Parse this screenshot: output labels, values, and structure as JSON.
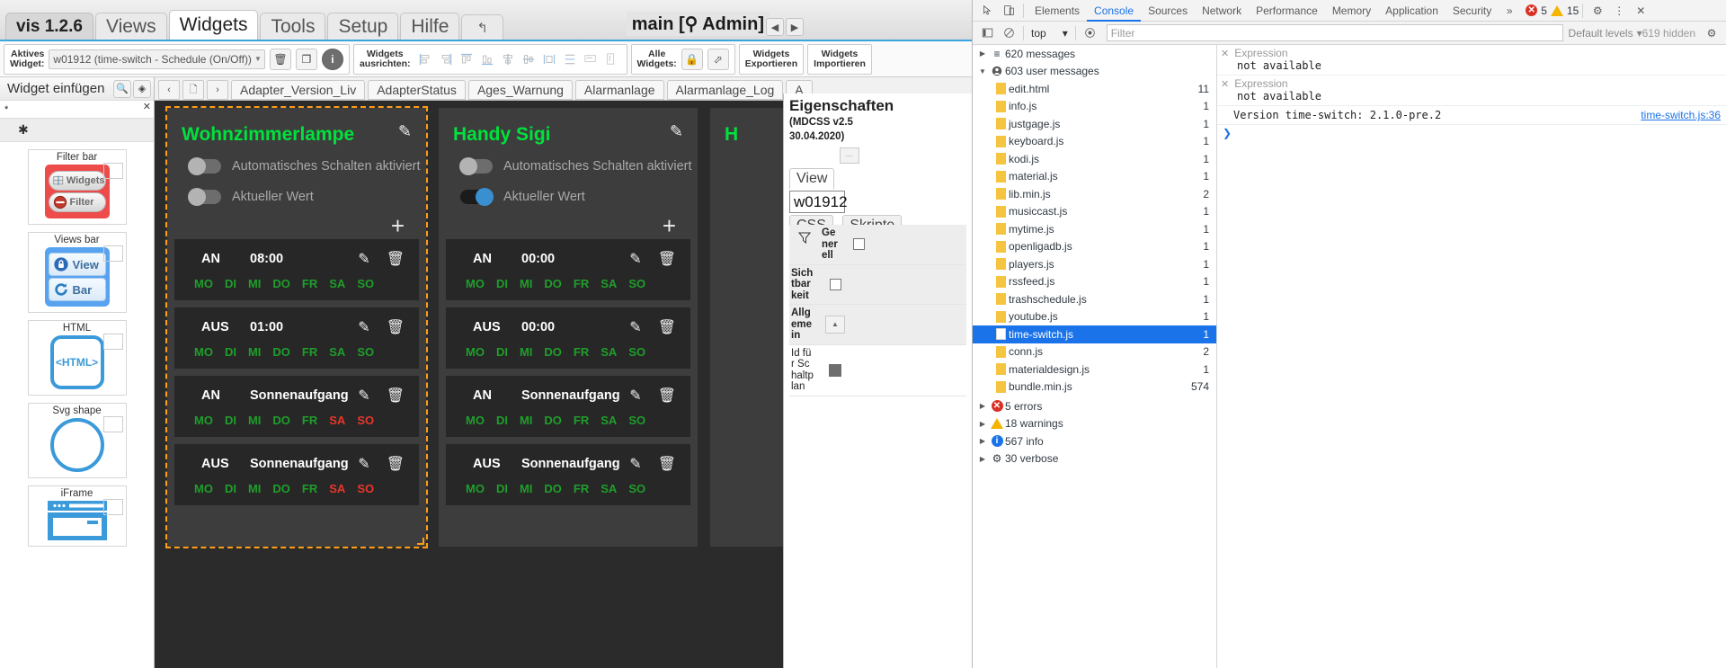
{
  "vis": {
    "menu": {
      "brand": "vis 1.2.6",
      "tabs": [
        "Views",
        "Widgets",
        "Tools",
        "Setup",
        "Hilfe"
      ],
      "active_tab": "Widgets",
      "undo_icon": "undo-arrow-icon",
      "window_title": "main [⚲ Admin]",
      "nav_prev": "◀",
      "nav_next": "▶"
    },
    "toolbar": {
      "active_widget_label": "Aktives\nWidget:",
      "active_widget_value": "w01912 (time-switch - Schedule (On/Off))",
      "delete_icon": "trash-icon",
      "copy_icon": "copy-icon",
      "info_icon": "info-icon",
      "align_label": "Widgets\nausrichten:",
      "align_icons": [
        "align-left-icon",
        "align-right-icon",
        "align-top-icon",
        "align-bottom-icon",
        "align-h-center-icon",
        "align-v-center-icon",
        "distribute-h-icon",
        "distribute-v-icon",
        "same-width-icon",
        "same-height-icon"
      ],
      "all_widgets_label": "Alle\nWidgets:",
      "lock_icon": "lock-icon",
      "expand_icon": "expand-icon",
      "export_label": "Widgets\nExportieren",
      "import_label": "Widgets\nImportieren"
    },
    "palette": {
      "title": "Widget einfügen",
      "search_icon": "search-icon",
      "pin_icon": "pin-icon",
      "close_icon": "close-icon",
      "filter_value": "*",
      "selected_group": "✱",
      "dropdown_icon": "chevron-down-icon",
      "items": [
        {
          "title": "Filter bar",
          "kind": "filter-bar",
          "buttons": [
            {
              "label": "Widgets",
              "icon": "grid-icon"
            },
            {
              "label": "Filter",
              "icon": "no-entry-icon"
            }
          ]
        },
        {
          "title": "Views bar",
          "kind": "views-bar",
          "buttons": [
            {
              "label": "View",
              "icon": "lock-circle-icon"
            },
            {
              "label": "Bar",
              "icon": "refresh-circle-icon"
            }
          ]
        },
        {
          "title": "HTML",
          "kind": "html",
          "glyph": "<HTML>"
        },
        {
          "title": "Svg shape",
          "kind": "svg"
        },
        {
          "title": "iFrame",
          "kind": "iframe"
        }
      ]
    },
    "view_tabs": {
      "prev_icon": "chevron-left-icon",
      "copy_icon": "copy-view-icon",
      "next_icon": "chevron-right-icon",
      "tabs": [
        "Adapter_Version_Liv",
        "AdapterStatus",
        "Ages_Warnung",
        "Alarmanlage",
        "Alarmanlage_Log",
        "A"
      ]
    },
    "widgets": [
      {
        "title": "Wohnzimmerlampe",
        "selected": true,
        "edit_icon": "pencil-icon",
        "add_icon": "plus-icon",
        "toggles": [
          {
            "label": "Automatisches Schalten aktiviert",
            "on": false
          },
          {
            "label": "Aktueller Wert",
            "on": false
          }
        ],
        "schedules": [
          {
            "mode": "AN",
            "time": "08:00",
            "days": [
              true,
              true,
              true,
              true,
              true,
              true,
              true
            ]
          },
          {
            "mode": "AUS",
            "time": "01:00",
            "days": [
              true,
              true,
              true,
              true,
              true,
              true,
              true
            ]
          },
          {
            "mode": "AN",
            "time": "Sonnenaufgang",
            "days": [
              true,
              true,
              true,
              true,
              true,
              false,
              false
            ]
          },
          {
            "mode": "AUS",
            "time": "Sonnenaufgang",
            "days": [
              true,
              true,
              true,
              true,
              true,
              false,
              false
            ]
          }
        ]
      },
      {
        "title": "Handy Sigi",
        "selected": false,
        "edit_icon": "pencil-icon",
        "add_icon": "plus-icon",
        "toggles": [
          {
            "label": "Automatisches Schalten aktiviert",
            "on": false
          },
          {
            "label": "Aktueller Wert",
            "on": true
          }
        ],
        "schedules": [
          {
            "mode": "AN",
            "time": "00:00",
            "days": [
              true,
              true,
              true,
              true,
              true,
              true,
              true
            ]
          },
          {
            "mode": "AUS",
            "time": "00:00",
            "days": [
              true,
              true,
              true,
              true,
              true,
              true,
              true
            ]
          },
          {
            "mode": "AN",
            "time": "Sonnenaufgang",
            "days": [
              true,
              true,
              true,
              true,
              true,
              true,
              true
            ]
          },
          {
            "mode": "AUS",
            "time": "Sonnenaufgang",
            "days": [
              true,
              true,
              true,
              true,
              true,
              true,
              true
            ]
          }
        ]
      },
      {
        "title": "H",
        "selected": false,
        "edit_icon": "pencil-icon",
        "add_icon": "plus-icon",
        "toggles": [],
        "schedules": []
      }
    ],
    "day_labels": [
      "MO",
      "DI",
      "MI",
      "DO",
      "FR",
      "SA",
      "SO"
    ],
    "day_on_color": "#1f9e2b",
    "day_off_color": "#e8372c",
    "title_color": "#00e23c",
    "selection_color": "#ff9d17",
    "properties": {
      "title": "Eigenschaften",
      "subtitle_line1": "(MDCSS v2.5",
      "subtitle_line2": "30.04.2020)",
      "grip_icon": "drag-grip-icon",
      "tabs": [
        "View",
        "CSS",
        "Skripte"
      ],
      "active_tab": "View",
      "widget_id": "w01912",
      "filter_icon": "funnel-icon",
      "rows": [
        {
          "label": "Generell",
          "type": "group",
          "control": "checkbox"
        },
        {
          "label": "Sichtbarkeit",
          "type": "group",
          "control": "checkbox"
        },
        {
          "label": "Allgemein",
          "type": "group",
          "control": "sort"
        },
        {
          "label": "Id für Schaltplan",
          "type": "field",
          "control": "dark"
        }
      ]
    }
  },
  "devtools": {
    "toolbar": {
      "inspect_icon": "inspect-cursor-icon",
      "device_icon": "device-toolbar-icon",
      "tabs": [
        "Elements",
        "Console",
        "Sources",
        "Network",
        "Performance",
        "Memory",
        "Application",
        "Security"
      ],
      "active_tab": "Console",
      "overflow_icon": "chevron-double-right-icon",
      "error_count": "5",
      "warning_count": "15",
      "settings_icon": "gear-icon",
      "more_icon": "kebab-menu-icon",
      "close_icon": "close-icon"
    },
    "filterbar": {
      "sidebar_toggle_icon": "sidebar-toggle-icon",
      "clear_icon": "clear-console-icon",
      "context": "top",
      "context_caret": "▾",
      "eye_icon": "live-expression-icon",
      "filter_placeholder": "Filter",
      "levels_label": "Default levels",
      "levels_caret": "▾",
      "hidden_label": "619 hidden",
      "settings_icon": "gear-icon"
    },
    "sidebar": {
      "groups": [
        {
          "label": "620 messages",
          "count": "",
          "expanded": false,
          "icon": "list-icon"
        },
        {
          "label": "603 user messages",
          "count": "",
          "expanded": true,
          "icon": "user-icon"
        }
      ],
      "files": [
        {
          "name": "edit.html",
          "count": "11",
          "selected": false
        },
        {
          "name": "info.js",
          "count": "1",
          "selected": false
        },
        {
          "name": "justgage.js",
          "count": "1",
          "selected": false
        },
        {
          "name": "keyboard.js",
          "count": "1",
          "selected": false
        },
        {
          "name": "kodi.js",
          "count": "1",
          "selected": false
        },
        {
          "name": "material.js",
          "count": "1",
          "selected": false
        },
        {
          "name": "lib.min.js",
          "count": "2",
          "selected": false
        },
        {
          "name": "musiccast.js",
          "count": "1",
          "selected": false
        },
        {
          "name": "mytime.js",
          "count": "1",
          "selected": false
        },
        {
          "name": "openligadb.js",
          "count": "1",
          "selected": false
        },
        {
          "name": "players.js",
          "count": "1",
          "selected": false
        },
        {
          "name": "rssfeed.js",
          "count": "1",
          "selected": false
        },
        {
          "name": "trashschedule.js",
          "count": "1",
          "selected": false
        },
        {
          "name": "youtube.js",
          "count": "1",
          "selected": false
        },
        {
          "name": "time-switch.js",
          "count": "1",
          "selected": true
        },
        {
          "name": "conn.js",
          "count": "2",
          "selected": false
        },
        {
          "name": "materialdesign.js",
          "count": "1",
          "selected": false
        },
        {
          "name": "bundle.min.js",
          "count": "574",
          "selected": false
        }
      ],
      "footer": [
        {
          "label": "5 errors",
          "icon": "error-icon"
        },
        {
          "label": "18 warnings",
          "icon": "warning-icon"
        },
        {
          "label": "567 info",
          "icon": "info-icon"
        },
        {
          "label": "30 verbose",
          "icon": "verbose-icon"
        }
      ]
    },
    "console": {
      "entries": [
        {
          "head": "Expression",
          "body": "not available",
          "close_icon": "close-icon"
        },
        {
          "head": "Expression",
          "body": "not available",
          "close_icon": "close-icon"
        }
      ],
      "version_line": "Version time-switch: 2.1.0-pre.2",
      "version_source": "time-switch.js:36",
      "prompt": "❯"
    }
  }
}
